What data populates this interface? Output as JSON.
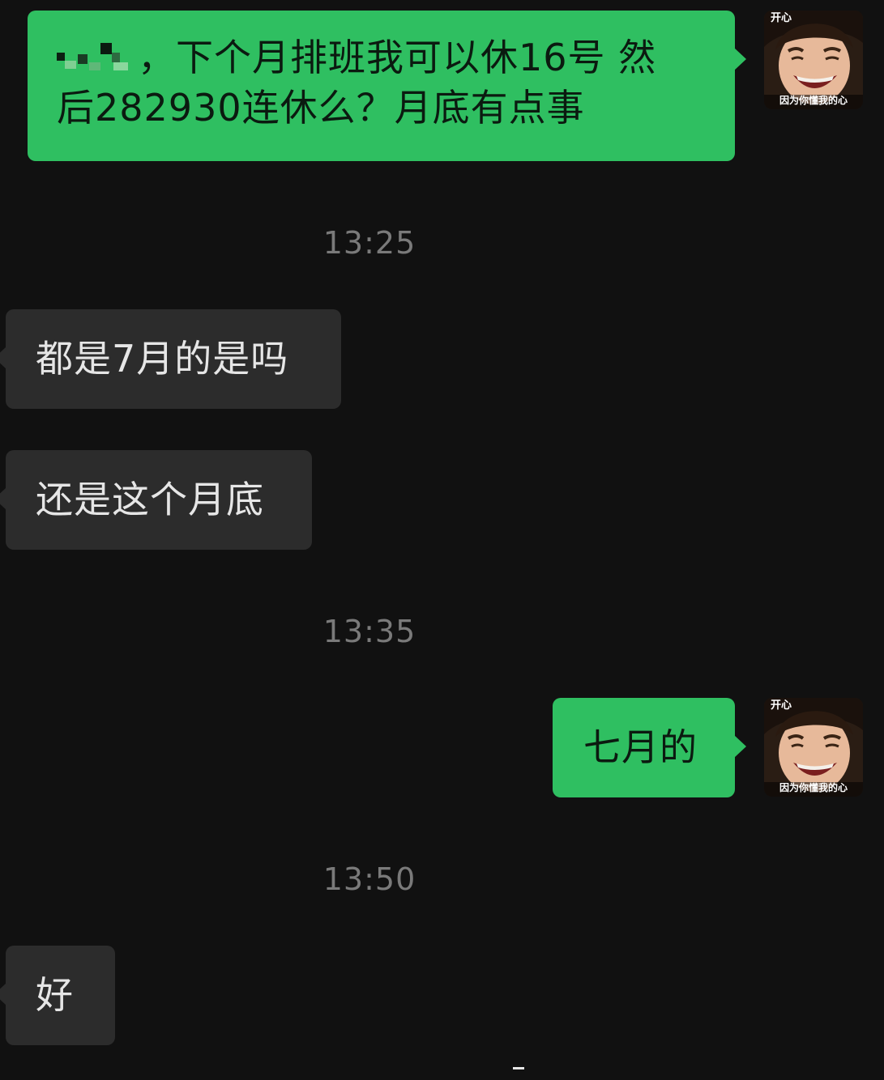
{
  "messages": [
    {
      "side": "out",
      "redacted_name": true,
      "text_line1": "，下个月排班我可以休16号  然",
      "text_line2": "后282930连休么？月底有点事"
    },
    {
      "side": "in",
      "text": "都是7月的是吗"
    },
    {
      "side": "in",
      "text": "还是这个月底"
    },
    {
      "side": "out",
      "text": "七月的"
    },
    {
      "side": "in",
      "text": "好"
    }
  ],
  "timestamps": [
    "13:25",
    "13:35",
    "13:50"
  ],
  "avatar": {
    "caption_top": "开心",
    "caption_bottom": "因为你懂我的心"
  },
  "colors": {
    "background": "#111111",
    "outgoing_bubble": "#2fbf61",
    "incoming_bubble": "#2c2c2c",
    "timestamp_text": "#7a7a7a"
  }
}
